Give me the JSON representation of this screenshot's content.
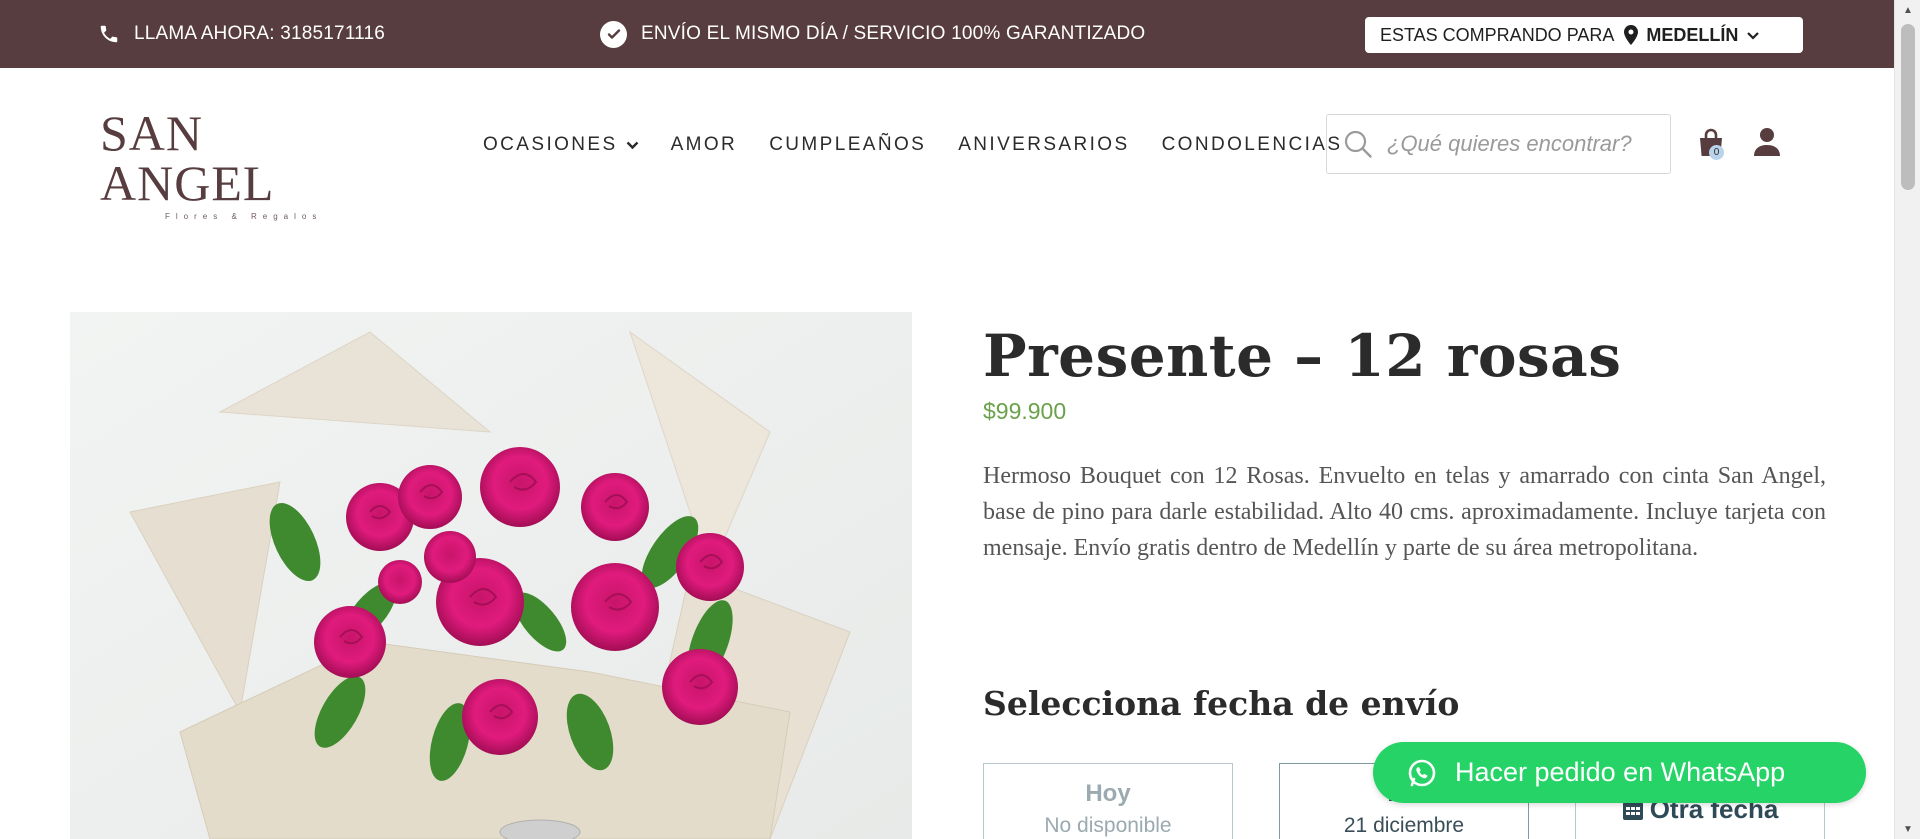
{
  "topbar": {
    "call_text": "LLAMA AHORA: 3185171116",
    "ship_text": "ENVÍO EL MISMO DÍA / SERVICIO 100% GARANTIZADO",
    "buying_for_label": "ESTAS COMPRANDO PARA",
    "city": "MEDELLÍN",
    "background_color": "#573d3f"
  },
  "header": {
    "logo_text": "SAN ANGEL",
    "logo_tagline": "Flores & Regalos",
    "nav": [
      {
        "label": "OCASIONES",
        "has_dropdown": true
      },
      {
        "label": "AMOR"
      },
      {
        "label": "CUMPLEAÑOS"
      },
      {
        "label": "ANIVERSARIOS"
      },
      {
        "label": "CONDOLENCIAS"
      }
    ],
    "search_placeholder": "¿Qué quieres encontrar?",
    "cart_count": "0"
  },
  "product": {
    "title": "Presente – 12 rosas",
    "price": "$99.900",
    "price_color": "#6aa14a",
    "description": "Hermoso Bouquet con 12 Rosas. Envuelto en telas y amarrado con cinta San Angel, base de pino para darle estabilidad. Alto 40 cms. aproximadamente. Incluye tarjeta con mensaje. Envío gratis dentro de Medellín y parte de su área metropolitana.",
    "delivery_heading": "Selecciona fecha de envío",
    "delivery_options": [
      {
        "label": "Hoy",
        "sub": "No disponible"
      },
      {
        "label": "Ma",
        "sub": "21 diciembre"
      },
      {
        "label": "Otra fecha",
        "icon": "calendar-icon"
      }
    ]
  },
  "whatsapp": {
    "label": "Hacer pedido en WhatsApp",
    "color": "#25d366"
  }
}
